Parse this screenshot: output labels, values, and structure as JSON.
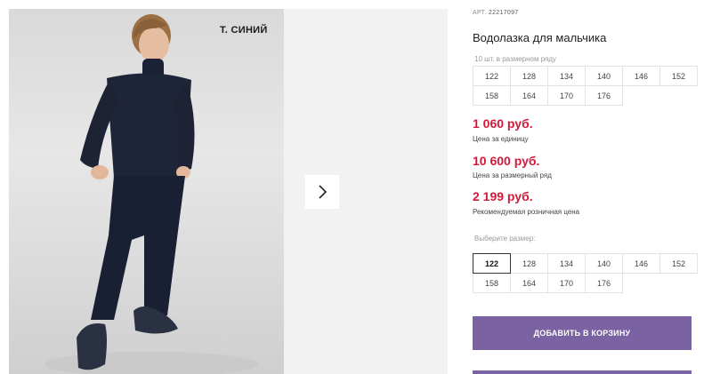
{
  "gallery": {
    "color_label": "т. синий",
    "next_icon": "chevron-right-icon"
  },
  "product": {
    "article_prefix": "АРТ.",
    "article_number": "22217097",
    "title": "Водолазка для мальчика",
    "range_label": "10 шт. в размерном ряду",
    "range_sizes": [
      "122",
      "128",
      "134",
      "140",
      "146",
      "152",
      "158",
      "164",
      "170",
      "176"
    ]
  },
  "prices": {
    "unit_price": "1 060 руб.",
    "unit_note": "Цена за единицу",
    "range_price": "10 600 руб.",
    "range_note": "Цена за размерный ряд",
    "retail_price": "2 199 руб.",
    "retail_note": "Рекомендуемая розничная цена"
  },
  "size_picker": {
    "label": "Выберите размер:",
    "sizes": [
      "122",
      "128",
      "134",
      "140",
      "146",
      "152",
      "158",
      "164",
      "170",
      "176"
    ],
    "selected": "122"
  },
  "cart": {
    "add_label": "ДОБАВИТЬ В КОРЗИНУ"
  },
  "colors": {
    "price_red": "#d11a3a",
    "button_purple": "#7a62a3"
  }
}
